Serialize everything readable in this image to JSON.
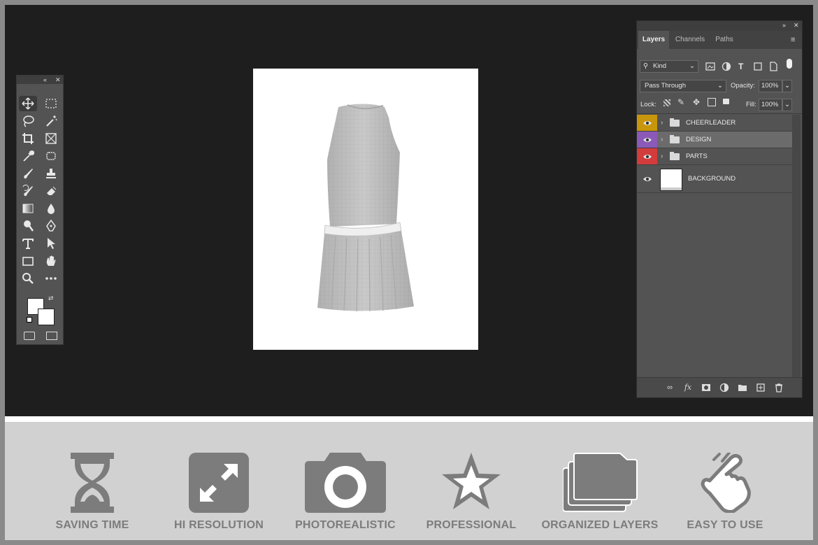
{
  "tools_panel": {
    "collapse_icon": "double-chevron-left-icon",
    "close_icon": "close-icon",
    "tools": [
      {
        "name": "move-tool",
        "icon": "move-icon",
        "active": true
      },
      {
        "name": "marquee-tool",
        "icon": "rect-marquee-icon"
      },
      {
        "name": "lasso-tool",
        "icon": "lasso-icon"
      },
      {
        "name": "magic-wand-tool",
        "icon": "magic-wand-icon"
      },
      {
        "name": "crop-tool",
        "icon": "crop-icon"
      },
      {
        "name": "frame-tool",
        "icon": "frame-icon"
      },
      {
        "name": "eyedropper-tool",
        "icon": "eyedropper-icon"
      },
      {
        "name": "patch-tool",
        "icon": "patch-icon"
      },
      {
        "name": "brush-tool",
        "icon": "brush-icon"
      },
      {
        "name": "stamp-tool",
        "icon": "stamp-icon"
      },
      {
        "name": "history-brush-tool",
        "icon": "history-brush-icon"
      },
      {
        "name": "eraser-tool",
        "icon": "eraser-icon"
      },
      {
        "name": "gradient-tool",
        "icon": "gradient-icon"
      },
      {
        "name": "blur-tool",
        "icon": "drop-icon"
      },
      {
        "name": "dodge-tool",
        "icon": "dodge-icon"
      },
      {
        "name": "pen-tool",
        "icon": "pen-icon"
      },
      {
        "name": "type-tool",
        "icon": "type-icon"
      },
      {
        "name": "path-select-tool",
        "icon": "arrow-icon"
      },
      {
        "name": "shape-tool",
        "icon": "rectangle-icon"
      },
      {
        "name": "hand-tool",
        "icon": "hand-icon"
      },
      {
        "name": "zoom-tool",
        "icon": "zoom-icon"
      },
      {
        "name": "more-tools",
        "icon": "ellipsis-icon"
      }
    ]
  },
  "document": {
    "image": "sleeveless dress with pleated skirt on white background"
  },
  "layers_panel": {
    "tabs": [
      {
        "label": "Layers",
        "active": true
      },
      {
        "label": "Channels"
      },
      {
        "label": "Paths"
      }
    ],
    "filter_kind": "Kind",
    "blend_mode": "Pass Through",
    "opacity_label": "Opacity:",
    "opacity_value": "100%",
    "lock_label": "Lock:",
    "fill_label": "Fill:",
    "fill_value": "100%",
    "layers": [
      {
        "name": "CHEERLEADER",
        "type": "group",
        "color": "#c8960c",
        "selected": false
      },
      {
        "name": "DESIGN",
        "type": "group",
        "color": "#8b59b8",
        "selected": true
      },
      {
        "name": "PARTS",
        "type": "group",
        "color": "#d23c3c",
        "selected": false
      },
      {
        "name": "BACKGROUND",
        "type": "layer",
        "color": "",
        "selected": false
      }
    ]
  },
  "features": [
    {
      "label": "SAVING TIME",
      "icon": "hourglass-icon"
    },
    {
      "label": "HI RESOLUTION",
      "icon": "expand-arrows-icon"
    },
    {
      "label": "PHOTOREALISTIC",
      "icon": "camera-icon"
    },
    {
      "label": "PROFESSIONAL",
      "icon": "star-icon"
    },
    {
      "label": "ORGANIZED LAYERS",
      "icon": "stacked-folders-icon"
    },
    {
      "label": "EASY TO USE",
      "icon": "tap-hand-icon"
    }
  ],
  "colors": {
    "workspace": "#1e1e1e",
    "panel": "#535353",
    "feature_strip": "#d1d1d1",
    "feature_icon": "#7c7c7c"
  }
}
